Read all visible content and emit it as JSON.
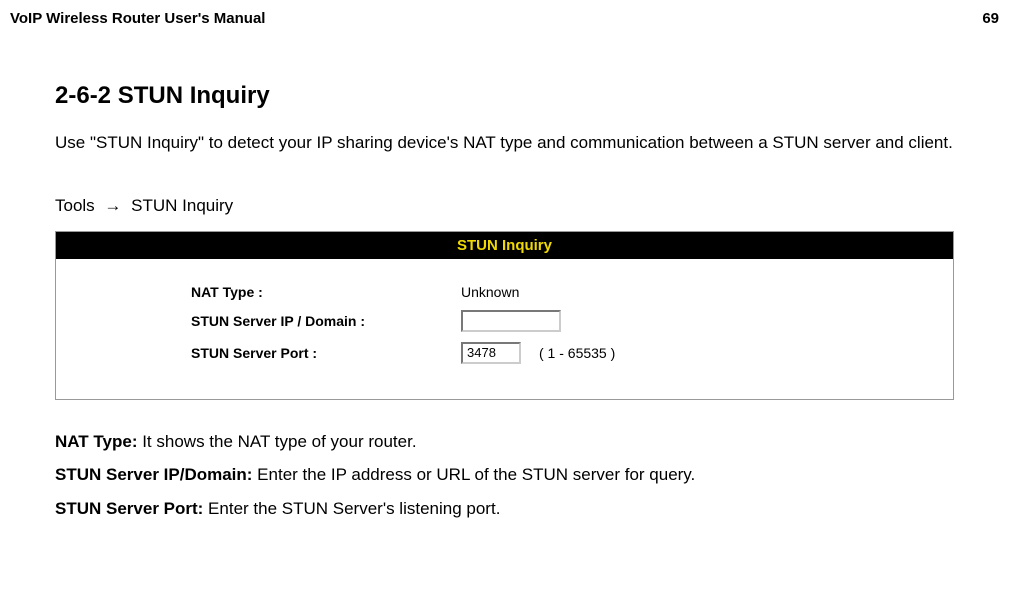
{
  "header": {
    "title": "VoIP Wireless Router User's Manual",
    "page_number": "69"
  },
  "section": {
    "title": "2-6-2 STUN Inquiry",
    "intro": "Use \"STUN Inquiry\" to detect your IP sharing device's NAT type and communication between a STUN server and client."
  },
  "breadcrumb": {
    "level1": "Tools",
    "arrow": "→",
    "level2": "STUN Inquiry"
  },
  "panel": {
    "header": "STUN Inquiry",
    "rows": {
      "nat_type": {
        "label": "NAT Type :",
        "value": "Unknown"
      },
      "server_ip": {
        "label": "STUN Server IP / Domain :",
        "value": ""
      },
      "server_port": {
        "label": "STUN Server Port :",
        "value": "3478",
        "range": "( 1 - 65535 )"
      }
    }
  },
  "definitions": {
    "nat_type": {
      "label": "NAT Type:",
      "text": " It shows the NAT type of your router."
    },
    "server_ip": {
      "label": "STUN Server IP/Domain:",
      "text": " Enter the IP address or URL of the STUN server for query."
    },
    "server_port": {
      "label": "STUN Server Port:",
      "text": " Enter the STUN Server's listening port."
    }
  }
}
